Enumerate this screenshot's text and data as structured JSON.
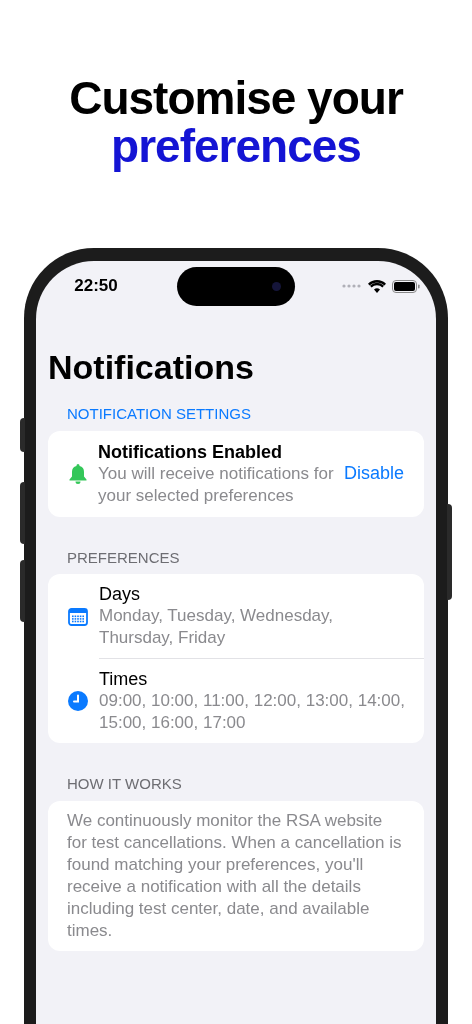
{
  "headline": {
    "line_1": "Customise your",
    "line_2": "preferences"
  },
  "status_bar": {
    "time": "22:50"
  },
  "title": "Notifications",
  "sections": [
    {
      "header": "NOTIFICATION SETTINGS",
      "highlighted": true,
      "kind": "status",
      "status": {
        "title": "Notifications Enabled",
        "subtitle": "You will receive notifications for your selected preferences",
        "enabled": true,
        "action": "Disable"
      }
    },
    {
      "header": "PREFERENCES",
      "highlighted": false,
      "kind": "list",
      "rows": [
        {
          "kind": "calendar",
          "title": "Days",
          "value": "Monday, Tuesday, Wednesday, Thursday, Friday"
        },
        {
          "kind": "clock",
          "title": "Times",
          "value": "09:00, 10:00, 11:00, 12:00, 13:00, 14:00, 15:00, 16:00, 17:00"
        }
      ]
    },
    {
      "header": "HOW IT WORKS",
      "highlighted": false,
      "kind": "text",
      "text": "We continuously monitor the RSA website for test cancellations. When a cancellation is found matching your preferences, you'll receive a notification with all the details including test center, date, and available times."
    }
  ]
}
